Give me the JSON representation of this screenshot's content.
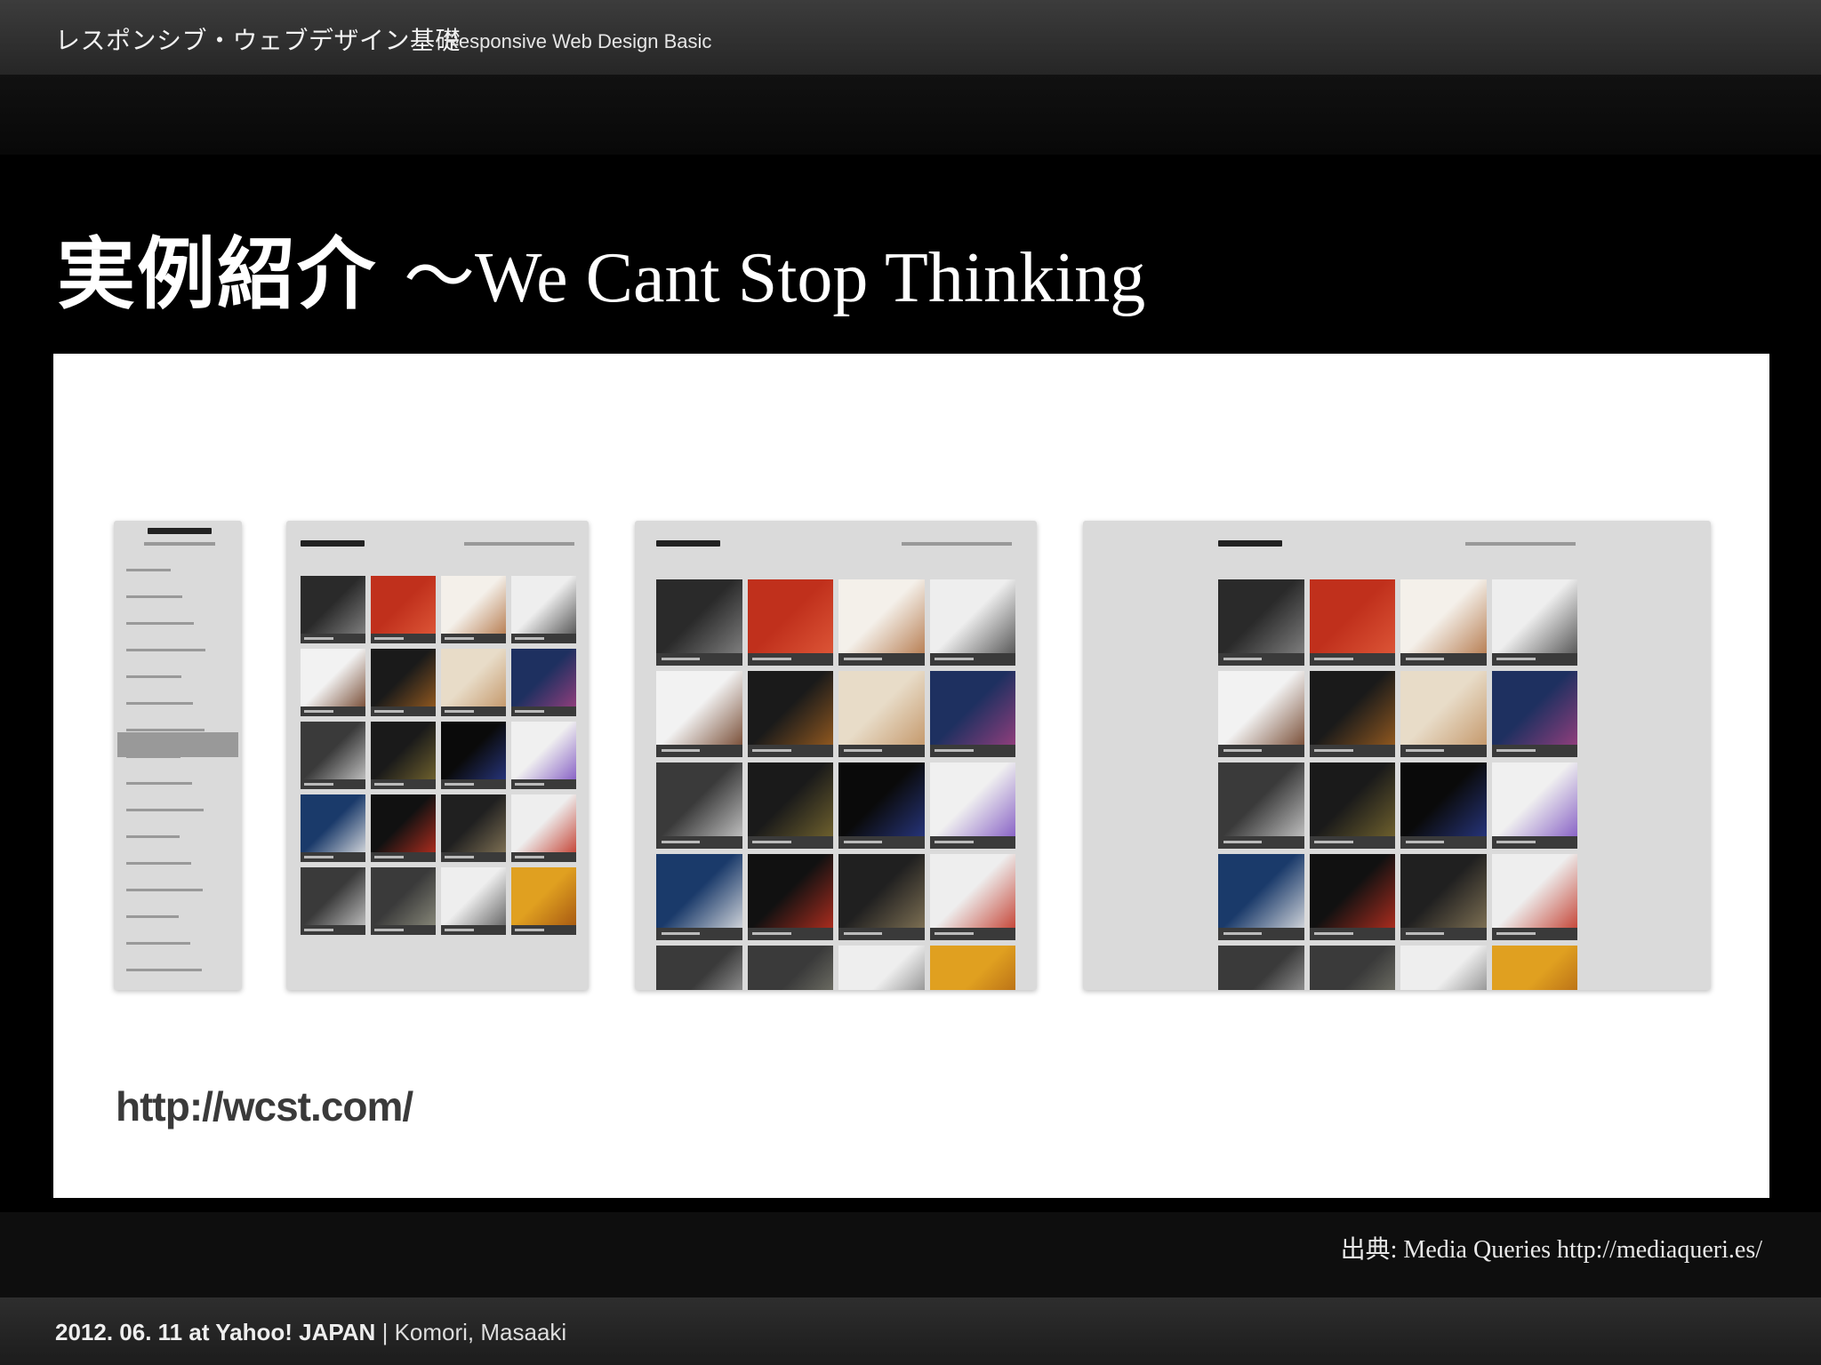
{
  "header": {
    "title": "レスポンシブ・ウェブデザイン基礎",
    "subtitle": "Responsive Web Design Basic"
  },
  "slide": {
    "title_jp": "実例紹介",
    "title_en": "～We Cant Stop Thinking"
  },
  "content": {
    "url": "http://wcst.com/"
  },
  "source": {
    "text": "出典: Media Queries http://mediaqueri.es/"
  },
  "footer": {
    "date_place": "2012. 06. 11 at Yahoo! JAPAN",
    "separator": "|",
    "author": "Komori, Masaaki"
  },
  "colors": {
    "background": "#000000",
    "panel": "#ffffff",
    "device_frame": "#dadada",
    "tile_dark": "#333333",
    "tile_red": "#c0301c",
    "tile_purple": "#7a4fc0",
    "tile_orange": "#e0a020"
  }
}
